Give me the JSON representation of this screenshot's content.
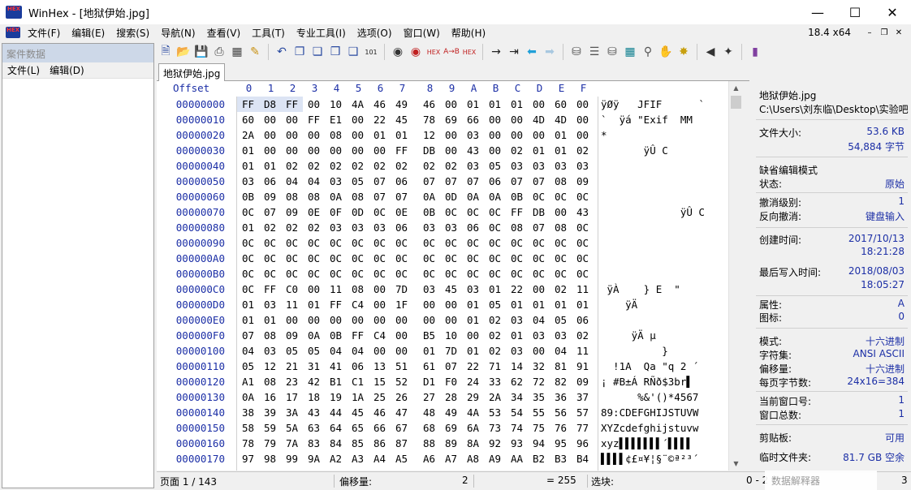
{
  "window": {
    "title": "WinHex - [地狱伊始.jpg]",
    "app_icon_text": "HEX"
  },
  "menubar": {
    "items": [
      "文件(F)",
      "编辑(E)",
      "搜索(S)",
      "导航(N)",
      "查看(V)",
      "工具(T)",
      "专业工具(I)",
      "选项(O)",
      "窗口(W)",
      "帮助(H)"
    ],
    "version": "18.4 x64"
  },
  "left_pane": {
    "title": "案件数据",
    "menu": [
      "文件(L)",
      "编辑(D)"
    ]
  },
  "tab": {
    "label": "地狱伊始.jpg"
  },
  "hex_view": {
    "offset_header": "Offset",
    "col_headers": [
      "0",
      "1",
      "2",
      "3",
      "4",
      "5",
      "6",
      "7",
      "8",
      "9",
      "A",
      "B",
      "C",
      "D",
      "E",
      "F"
    ],
    "rows": [
      {
        "offset": "00000000",
        "bytes": [
          "FF",
          "D8",
          "FF",
          "00",
          "10",
          "4A",
          "46",
          "49",
          "46",
          "00",
          "01",
          "01",
          "01",
          "00",
          "60",
          "00"
        ],
        "text": "ÿØÿ   JFIF      `"
      },
      {
        "offset": "00000010",
        "bytes": [
          "60",
          "00",
          "00",
          "FF",
          "E1",
          "00",
          "22",
          "45",
          "78",
          "69",
          "66",
          "00",
          "00",
          "4D",
          "4D",
          "00"
        ],
        "text": "`  ÿá \"Exif  MM"
      },
      {
        "offset": "00000020",
        "bytes": [
          "2A",
          "00",
          "00",
          "00",
          "08",
          "00",
          "01",
          "01",
          "12",
          "00",
          "03",
          "00",
          "00",
          "00",
          "01",
          "00"
        ],
        "text": "*"
      },
      {
        "offset": "00000030",
        "bytes": [
          "01",
          "00",
          "00",
          "00",
          "00",
          "00",
          "00",
          "FF",
          "DB",
          "00",
          "43",
          "00",
          "02",
          "01",
          "01",
          "02"
        ],
        "text": "       ÿÛ C"
      },
      {
        "offset": "00000040",
        "bytes": [
          "01",
          "01",
          "02",
          "02",
          "02",
          "02",
          "02",
          "02",
          "02",
          "02",
          "03",
          "05",
          "03",
          "03",
          "03",
          "03"
        ],
        "text": ""
      },
      {
        "offset": "00000050",
        "bytes": [
          "03",
          "06",
          "04",
          "04",
          "03",
          "05",
          "07",
          "06",
          "07",
          "07",
          "07",
          "06",
          "07",
          "07",
          "08",
          "09"
        ],
        "text": ""
      },
      {
        "offset": "00000060",
        "bytes": [
          "0B",
          "09",
          "08",
          "08",
          "0A",
          "08",
          "07",
          "07",
          "0A",
          "0D",
          "0A",
          "0A",
          "0B",
          "0C",
          "0C",
          "0C"
        ],
        "text": ""
      },
      {
        "offset": "00000070",
        "bytes": [
          "0C",
          "07",
          "09",
          "0E",
          "0F",
          "0D",
          "0C",
          "0E",
          "0B",
          "0C",
          "0C",
          "0C",
          "FF",
          "DB",
          "00",
          "43"
        ],
        "text": "             ÿÛ C"
      },
      {
        "offset": "00000080",
        "bytes": [
          "01",
          "02",
          "02",
          "02",
          "03",
          "03",
          "03",
          "06",
          "03",
          "03",
          "06",
          "0C",
          "08",
          "07",
          "08",
          "0C"
        ],
        "text": ""
      },
      {
        "offset": "00000090",
        "bytes": [
          "0C",
          "0C",
          "0C",
          "0C",
          "0C",
          "0C",
          "0C",
          "0C",
          "0C",
          "0C",
          "0C",
          "0C",
          "0C",
          "0C",
          "0C",
          "0C"
        ],
        "text": ""
      },
      {
        "offset": "000000A0",
        "bytes": [
          "0C",
          "0C",
          "0C",
          "0C",
          "0C",
          "0C",
          "0C",
          "0C",
          "0C",
          "0C",
          "0C",
          "0C",
          "0C",
          "0C",
          "0C",
          "0C"
        ],
        "text": ""
      },
      {
        "offset": "000000B0",
        "bytes": [
          "0C",
          "0C",
          "0C",
          "0C",
          "0C",
          "0C",
          "0C",
          "0C",
          "0C",
          "0C",
          "0C",
          "0C",
          "0C",
          "0C",
          "0C",
          "0C"
        ],
        "text": ""
      },
      {
        "offset": "000000C0",
        "bytes": [
          "0C",
          "FF",
          "C0",
          "00",
          "11",
          "08",
          "00",
          "7D",
          "03",
          "45",
          "03",
          "01",
          "22",
          "00",
          "02",
          "11"
        ],
        "text": " ÿÀ    } E  \""
      },
      {
        "offset": "000000D0",
        "bytes": [
          "01",
          "03",
          "11",
          "01",
          "FF",
          "C4",
          "00",
          "1F",
          "00",
          "00",
          "01",
          "05",
          "01",
          "01",
          "01",
          "01"
        ],
        "text": "    ÿÄ"
      },
      {
        "offset": "000000E0",
        "bytes": [
          "01",
          "01",
          "00",
          "00",
          "00",
          "00",
          "00",
          "00",
          "00",
          "00",
          "01",
          "02",
          "03",
          "04",
          "05",
          "06"
        ],
        "text": ""
      },
      {
        "offset": "000000F0",
        "bytes": [
          "07",
          "08",
          "09",
          "0A",
          "0B",
          "FF",
          "C4",
          "00",
          "B5",
          "10",
          "00",
          "02",
          "01",
          "03",
          "03",
          "02"
        ],
        "text": "     ÿÄ µ"
      },
      {
        "offset": "00000100",
        "bytes": [
          "04",
          "03",
          "05",
          "05",
          "04",
          "04",
          "00",
          "00",
          "01",
          "7D",
          "01",
          "02",
          "03",
          "00",
          "04",
          "11"
        ],
        "text": "          }"
      },
      {
        "offset": "00000110",
        "bytes": [
          "05",
          "12",
          "21",
          "31",
          "41",
          "06",
          "13",
          "51",
          "61",
          "07",
          "22",
          "71",
          "14",
          "32",
          "81",
          "91"
        ],
        "text": "  !1A  Qa \"q 2 ´"
      },
      {
        "offset": "00000120",
        "bytes": [
          "A1",
          "08",
          "23",
          "42",
          "B1",
          "C1",
          "15",
          "52",
          "D1",
          "F0",
          "24",
          "33",
          "62",
          "72",
          "82",
          "09"
        ],
        "text": "¡ #B±Á RÑð$3br▌"
      },
      {
        "offset": "00000130",
        "bytes": [
          "0A",
          "16",
          "17",
          "18",
          "19",
          "1A",
          "25",
          "26",
          "27",
          "28",
          "29",
          "2A",
          "34",
          "35",
          "36",
          "37"
        ],
        "text": "      %&'()*4567"
      },
      {
        "offset": "00000140",
        "bytes": [
          "38",
          "39",
          "3A",
          "43",
          "44",
          "45",
          "46",
          "47",
          "48",
          "49",
          "4A",
          "53",
          "54",
          "55",
          "56",
          "57"
        ],
        "text": "89:CDEFGHIJSTUVW"
      },
      {
        "offset": "00000150",
        "bytes": [
          "58",
          "59",
          "5A",
          "63",
          "64",
          "65",
          "66",
          "67",
          "68",
          "69",
          "6A",
          "73",
          "74",
          "75",
          "76",
          "77"
        ],
        "text": "XYZcdefghijstuvw"
      },
      {
        "offset": "00000160",
        "bytes": [
          "78",
          "79",
          "7A",
          "83",
          "84",
          "85",
          "86",
          "87",
          "88",
          "89",
          "8A",
          "92",
          "93",
          "94",
          "95",
          "96"
        ],
        "text": "xyz▌▌▌▌▌▌▌´▌▌▌▌"
      },
      {
        "offset": "00000170",
        "bytes": [
          "97",
          "98",
          "99",
          "9A",
          "A2",
          "A3",
          "A4",
          "A5",
          "A6",
          "A7",
          "A8",
          "A9",
          "AA",
          "B2",
          "B3",
          "B4"
        ],
        "text": "▌▌▌▌¢£¤¥¦§¨©ª²³´"
      }
    ]
  },
  "info_pane": {
    "filename": "地狱伊始.jpg",
    "path": "C:\\Users\\刘东临\\Desktop\\实验吧",
    "file_size_label": "文件大小:",
    "file_size_kb": "53.6 KB",
    "file_size_bytes": "54,884 字节",
    "edit_mode": "缺省编辑模式",
    "state_label": "状态:",
    "state_value": "原始",
    "undo_level_label": "撤消级别:",
    "undo_level_value": "1",
    "reverse_undo_label": "反向撤消:",
    "reverse_undo_value": "键盘输入",
    "created_label": "创建时间:",
    "created_date": "2017/10/13",
    "created_time": "18:21:28",
    "modified_label": "最后写入时间:",
    "modified_date": "2018/08/03",
    "modified_time": "18:05:27",
    "attr_label": "属性:",
    "attr_value": "A",
    "icon_label": "图标:",
    "icon_value": "0",
    "mode_label": "模式:",
    "mode_value": "十六进制",
    "charset_label": "字符集:",
    "charset_value": "ANSI ASCII",
    "offset_label": "偏移量:",
    "offset_value": "十六进制",
    "bpp_label": "每页字节数:",
    "bpp_value": "24x16=384",
    "curwin_label": "当前窗口号:",
    "curwin_value": "1",
    "totalwin_label": "窗口总数:",
    "totalwin_value": "1",
    "clipboard_label": "剪贴板:",
    "clipboard_value": "可用",
    "temp_label": "临时文件夹:",
    "temp_value": "81.7 GB 空余"
  },
  "statusbar": {
    "page": "页面 1 / 143",
    "offset_label": "偏移量:",
    "offset_value": "2",
    "value_text": "= 255",
    "selection_label": "选块:",
    "selection_value": "0 - 2",
    "size_value": "3"
  },
  "ghost_overlay": "数据解释器"
}
